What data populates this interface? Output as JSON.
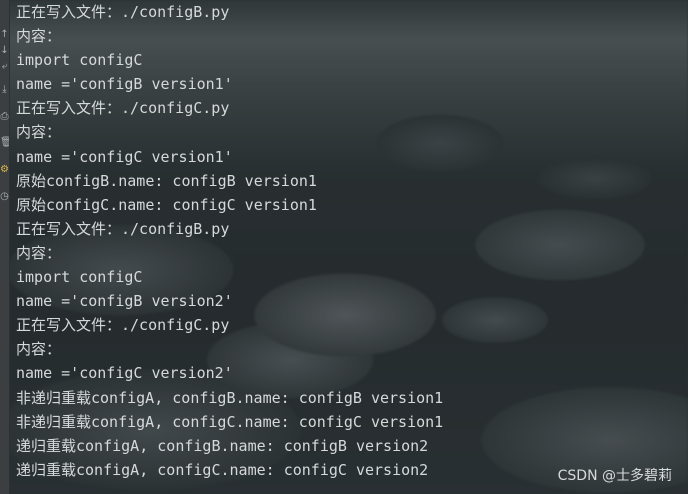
{
  "console": {
    "lines": [
      "正在写入文件：./configB.py",
      "内容：",
      "import configC",
      "name ='configB version1'",
      "正在写入文件：./configC.py",
      "内容：",
      "name ='configC version1'",
      "原始configB.name: configB version1",
      "原始configC.name: configC version1",
      "正在写入文件：./configB.py",
      "内容：",
      "import configC",
      "name ='configB version2'",
      "正在写入文件：./configC.py",
      "内容：",
      "name ='configC version2'",
      "非递归重载configA, configB.name: configB version1",
      "非递归重载configA, configC.name: configC version1",
      "递归重载configA, configB.name: configB version2",
      "递归重载configA, configC.name: configC version2"
    ]
  },
  "gutter": {
    "icons": [
      "arrow-up-icon",
      "arrow-down-icon",
      "wrap-icon",
      "scroll-to-end-icon",
      "print-icon",
      "trash-icon",
      "settings-icon",
      "history-icon"
    ]
  },
  "watermark": {
    "text": "CSDN @士多碧莉"
  }
}
